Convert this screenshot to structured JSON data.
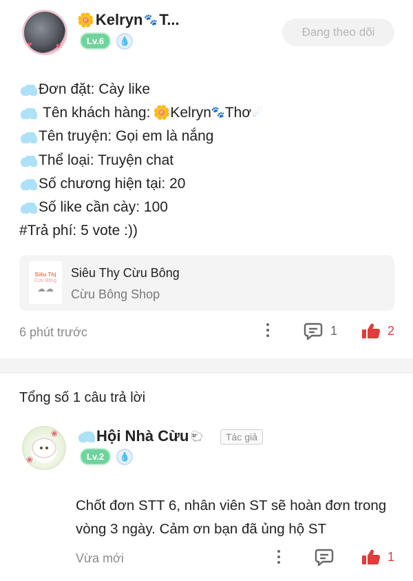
{
  "post": {
    "author": {
      "flower": "🌼",
      "name": "Kelryn",
      "paw": "🐾",
      "truncation": "T...",
      "level": "Lv.6"
    },
    "follow_label": "Đang theo dõi",
    "body": {
      "order": "Đơn đặt: Cày like",
      "customer_label": "Tên khách hàng: ",
      "customer_name": "Kelryn",
      "customer_suffix": "Thơ",
      "story": "Tên truyện: Gọi em là nắng",
      "genre": "Thể loại: Truyện chat",
      "chapters": "Số chương hiện tại: 20",
      "likes_needed": "Số like cần cày: 100",
      "fee": "#Trả phí: 5 vote :))"
    },
    "shop_card": {
      "name": "Siêu Thy Cừu Bông",
      "subtitle": "Cừu Bông Shop",
      "thumb_line1": "Siêu Thị",
      "thumb_line2": "Cừu Bông"
    },
    "time": "6 phút trước",
    "comment_count": "1",
    "like_count": "2"
  },
  "answers": {
    "title": "Tổng số 1 câu trả lời",
    "items": [
      {
        "author": "Hội Nhà Cừu",
        "sheep": "🐑",
        "author_tag": "Tác giả",
        "level": "Lv.2",
        "text": "Chốt đơn STT 6, nhân viên ST sẽ hoàn đơn trong vòng 3 ngày. Cảm ơn bạn đã ủng hộ ST",
        "time": "Vừa mới",
        "like_count": "1"
      }
    ]
  },
  "icons": [
    "avatar",
    "drop-icon",
    "kebab-icon",
    "comment-icon",
    "thumbs-up-icon",
    "cloud-icon"
  ],
  "colors": {
    "like_red": "#e23b3b",
    "level_green": "#6fd39b",
    "follow_bg": "#f2f2f2",
    "divider": "#f4f4f4"
  }
}
